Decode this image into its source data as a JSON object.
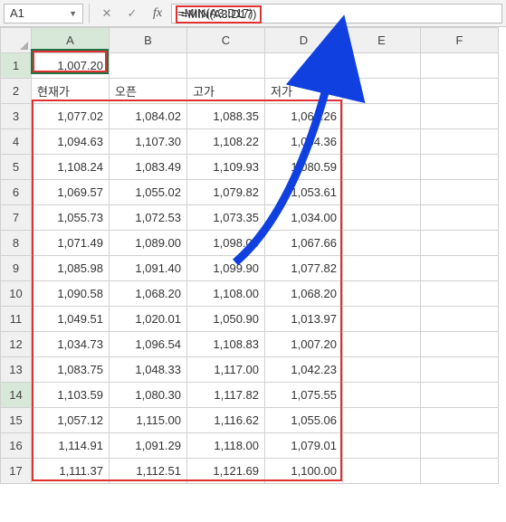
{
  "formula_bar": {
    "name_box": "A1",
    "formula": "=MIN(A3:D17)"
  },
  "columns": [
    "A",
    "B",
    "C",
    "D",
    "E",
    "F"
  ],
  "headers": {
    "c0": "현재가",
    "c1": "오픈",
    "c2": "고가",
    "c3": "저가"
  },
  "result_cell": "1,007.20",
  "rows": [
    {
      "n": "3",
      "a": "1,077.02",
      "b": "1,084.02",
      "c": "1,088.35",
      "d": "1,064.26"
    },
    {
      "n": "4",
      "a": "1,094.63",
      "b": "1,107.30",
      "c": "1,108.22",
      "d": "1,084.36"
    },
    {
      "n": "5",
      "a": "1,108.24",
      "b": "1,083.49",
      "c": "1,109.93",
      "d": "1,080.59"
    },
    {
      "n": "6",
      "a": "1,069.57",
      "b": "1,055.02",
      "c": "1,079.82",
      "d": "1,053.61"
    },
    {
      "n": "7",
      "a": "1,055.73",
      "b": "1,072.53",
      "c": "1,073.35",
      "d": "1,034.00"
    },
    {
      "n": "8",
      "a": "1,071.49",
      "b": "1,089.00",
      "c": "1,098.00",
      "d": "1,067.66"
    },
    {
      "n": "9",
      "a": "1,085.98",
      "b": "1,091.40",
      "c": "1,099.90",
      "d": "1,077.82"
    },
    {
      "n": "10",
      "a": "1,090.58",
      "b": "1,068.20",
      "c": "1,108.00",
      "d": "1,068.20"
    },
    {
      "n": "11",
      "a": "1,049.51",
      "b": "1,020.01",
      "c": "1,050.90",
      "d": "1,013.97"
    },
    {
      "n": "12",
      "a": "1,034.73",
      "b": "1,096.54",
      "c": "1,108.83",
      "d": "1,007.20"
    },
    {
      "n": "13",
      "a": "1,083.75",
      "b": "1,048.33",
      "c": "1,117.00",
      "d": "1,042.23"
    },
    {
      "n": "14",
      "a": "1,103.59",
      "b": "1,080.30",
      "c": "1,117.82",
      "d": "1,075.55"
    },
    {
      "n": "15",
      "a": "1,057.12",
      "b": "1,115.00",
      "c": "1,116.62",
      "d": "1,055.06"
    },
    {
      "n": "16",
      "a": "1,114.91",
      "b": "1,091.29",
      "c": "1,118.00",
      "d": "1,079.01"
    },
    {
      "n": "17",
      "a": "1,111.37",
      "b": "1,112.51",
      "c": "1,121.69",
      "d": "1,100.00"
    }
  ]
}
